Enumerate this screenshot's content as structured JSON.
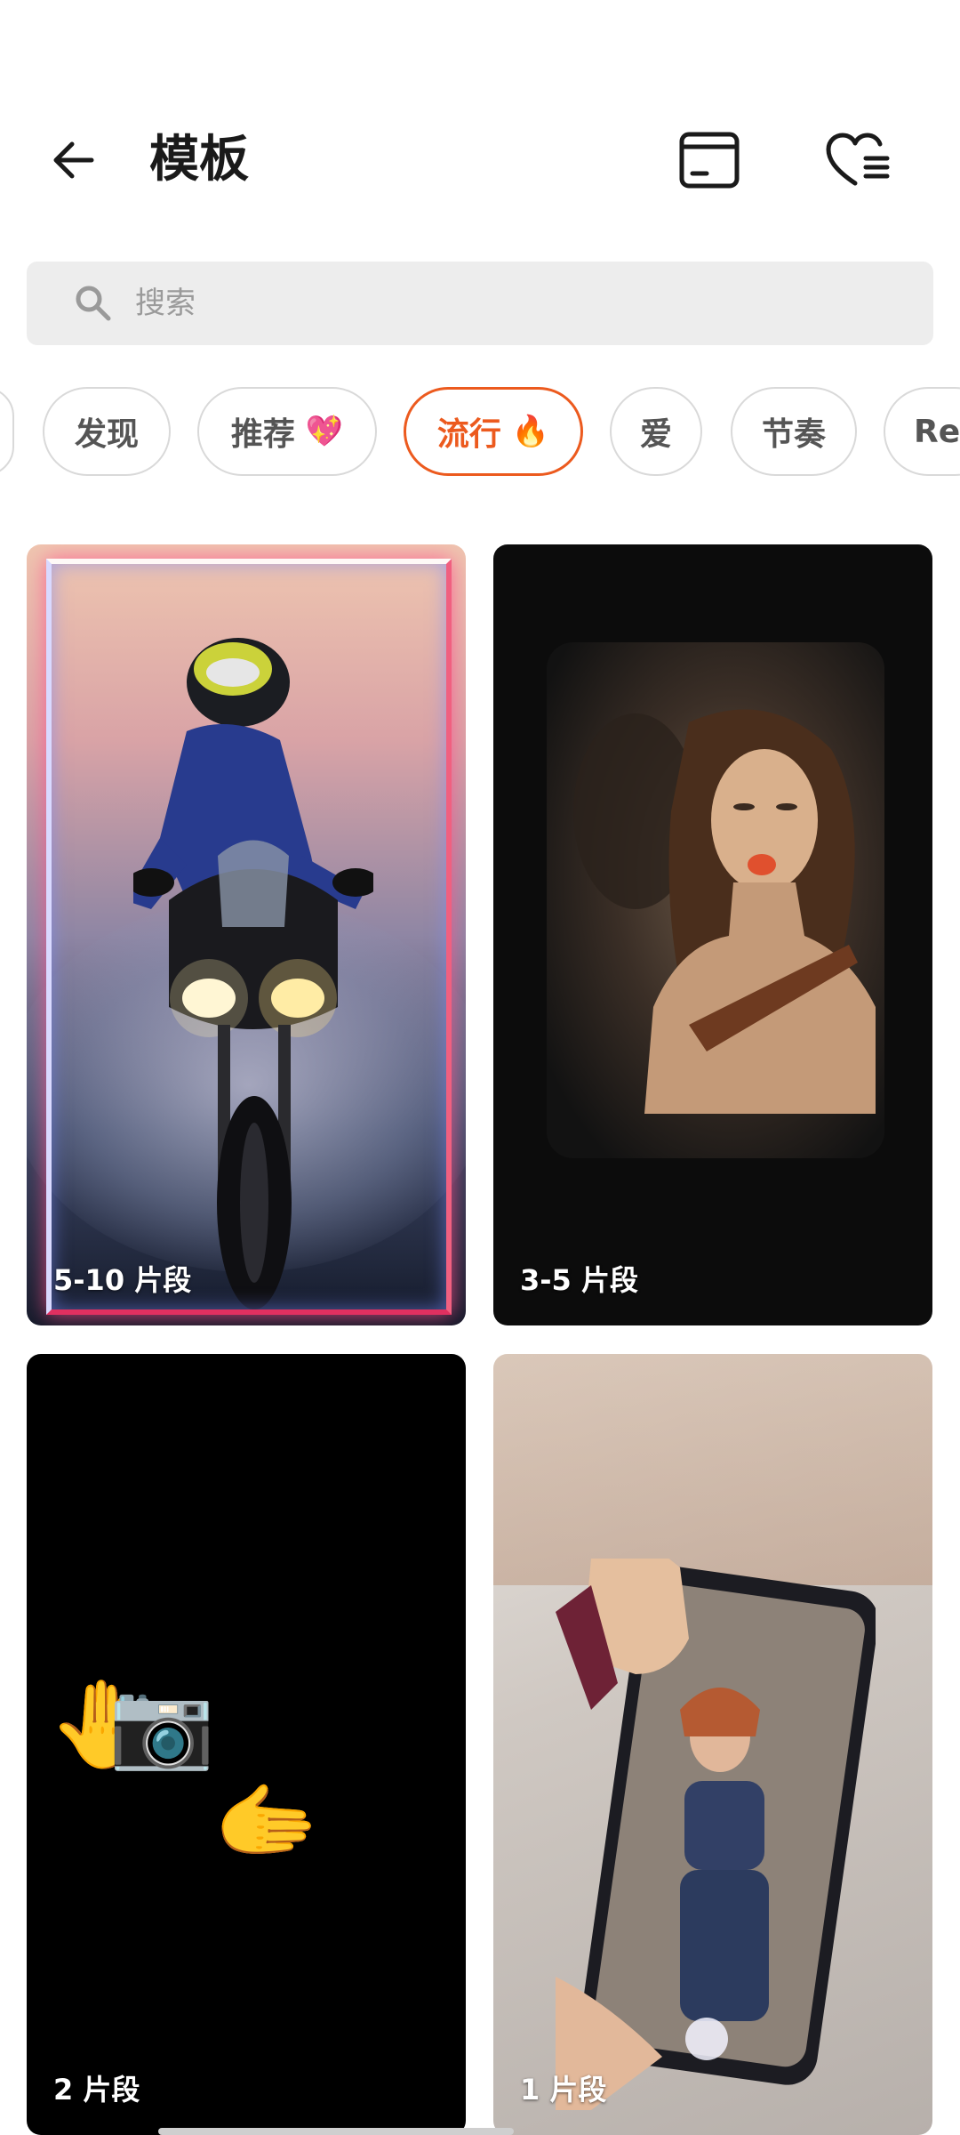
{
  "header": {
    "title": "模板",
    "back_icon": "arrow-left-icon",
    "drafts_icon": "drafts-box-icon",
    "favorites_icon": "heart-list-icon"
  },
  "search": {
    "placeholder": "搜索",
    "icon": "search-icon"
  },
  "chips": [
    {
      "label": "",
      "emoji": ""
    },
    {
      "label": "发现",
      "emoji": ""
    },
    {
      "label": "推荐",
      "emoji": "💖"
    },
    {
      "label": "流行",
      "emoji": "🔥",
      "active": true
    },
    {
      "label": "爱",
      "emoji": ""
    },
    {
      "label": "节奏",
      "emoji": ""
    },
    {
      "label": "Rec",
      "emoji": ""
    }
  ],
  "templates": [
    {
      "clips": "5-10 片段"
    },
    {
      "clips": "3-5 片段"
    },
    {
      "clips": "2 片段"
    },
    {
      "clips": "1 片段"
    }
  ],
  "colors": {
    "accent": "#ec5a1e",
    "chip_border": "#d9d9d9",
    "search_bg": "#ededed"
  }
}
